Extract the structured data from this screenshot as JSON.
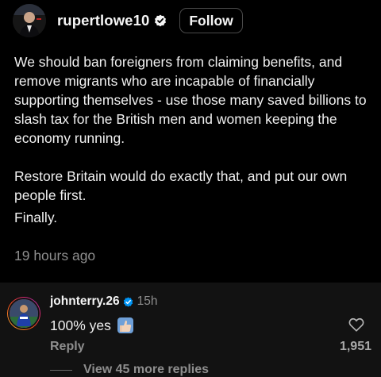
{
  "post": {
    "username": "rupertlowe10",
    "follow_label": "Follow",
    "paragraphs": [
      "We should ban foreigners from claiming benefits, and remove migrants who are incapable of financially supporting themselves - use those many saved billions to slash tax for the British men and women keeping the economy running.",
      "Restore Britain would do exactly that, and put our own people first.",
      "Finally."
    ],
    "timestamp": "19 hours ago"
  },
  "comment": {
    "username": "johnterry.26",
    "time": "15h",
    "text": "100% yes",
    "emoji_icon": "thumbs-up-emoji",
    "reply_label": "Reply",
    "likes": "1,951",
    "view_replies_label": "View 45 more replies"
  },
  "colors": {
    "background": "#000000",
    "comment_background": "#121212",
    "verified_blue": "#0095f6",
    "muted_text": "#8e8e8e"
  }
}
